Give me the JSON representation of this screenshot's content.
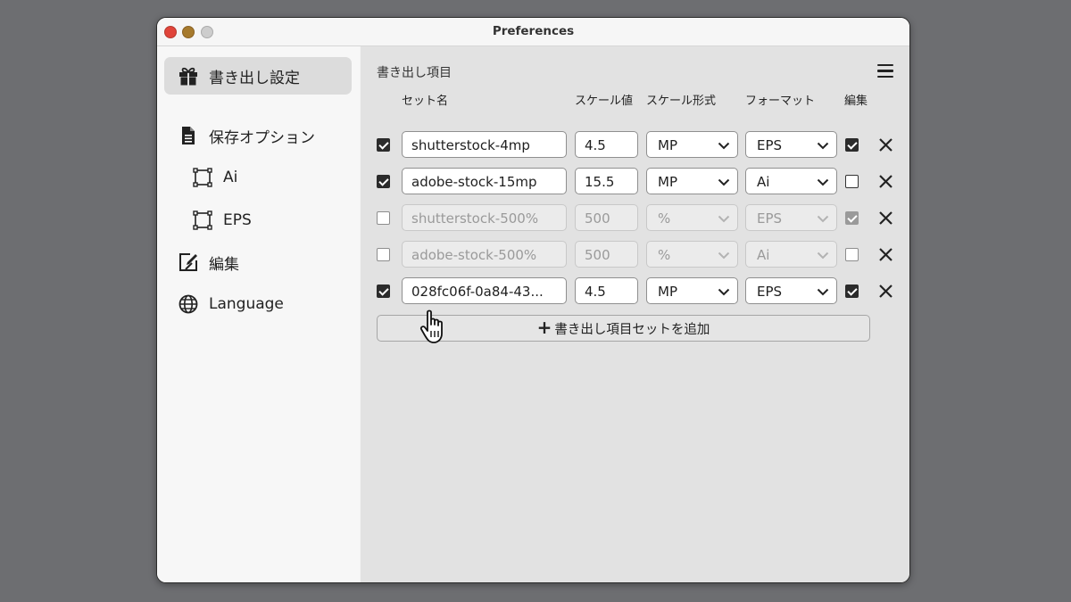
{
  "window": {
    "title": "Preferences"
  },
  "sidebar": {
    "items": [
      {
        "label": "書き出し設定",
        "icon": "gift-icon",
        "active": true
      },
      {
        "label": "保存オプション",
        "icon": "document-icon"
      },
      {
        "label": "Ai",
        "icon": "artboard-icon"
      },
      {
        "label": "EPS",
        "icon": "artboard-icon"
      },
      {
        "label": "編集",
        "icon": "edit-icon"
      },
      {
        "label": "Language",
        "icon": "globe-icon"
      }
    ]
  },
  "main": {
    "section_title": "書き出し項目",
    "menu_icon": "hamburger-menu-icon",
    "columns": {
      "set_name": "セット名",
      "scale_value": "スケール値",
      "scale_type": "スケール形式",
      "format": "フォーマット",
      "edit": "編集"
    },
    "rows": [
      {
        "enabled": true,
        "name": "shutterstock-4mp",
        "scale": "4.5",
        "scale_type": "MP",
        "format": "EPS",
        "edit": true
      },
      {
        "enabled": true,
        "name": "adobe-stock-15mp",
        "scale": "15.5",
        "scale_type": "MP",
        "format": "Ai",
        "edit": false
      },
      {
        "enabled": false,
        "name": "shutterstock-500%",
        "scale": "500",
        "scale_type": "%",
        "format": "EPS",
        "edit": true
      },
      {
        "enabled": false,
        "name": "adobe-stock-500%",
        "scale": "500",
        "scale_type": "%",
        "format": "Ai",
        "edit": false
      },
      {
        "enabled": true,
        "name": "028fc06f-0a84-43...",
        "scale": "4.5",
        "scale_type": "MP",
        "format": "EPS",
        "edit": true
      }
    ],
    "add_button": {
      "icon": "plus-icon",
      "label": "書き出し項目セットを追加"
    }
  },
  "colors": {
    "sidebar_bg": "#f7f7f7",
    "content_bg": "#e2e2e2",
    "active_item_bg": "#dcdcdc",
    "desktop_bg": "#6d6e71"
  }
}
